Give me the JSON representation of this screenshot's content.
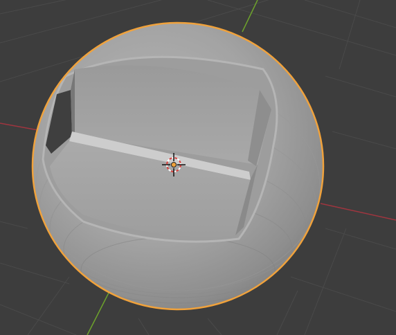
{
  "viewport": {
    "background_color": "#3d3d3d",
    "grid_color": "#4a4a4a"
  },
  "axes": {
    "x_axis_color": "#a0353f",
    "y_axis_color": "#6da22c"
  },
  "object": {
    "shape": "sphere-with-carved-seat",
    "selected": true,
    "outline_color": "#f0a23c",
    "shading": "solid-gray"
  },
  "cursor_3d": {
    "icon": "3d-cursor-icon",
    "ring_colors": [
      "#d9403c",
      "#ffffff"
    ]
  },
  "origin": {
    "icon": "origin-dot-icon",
    "color": "#f0a23c"
  }
}
